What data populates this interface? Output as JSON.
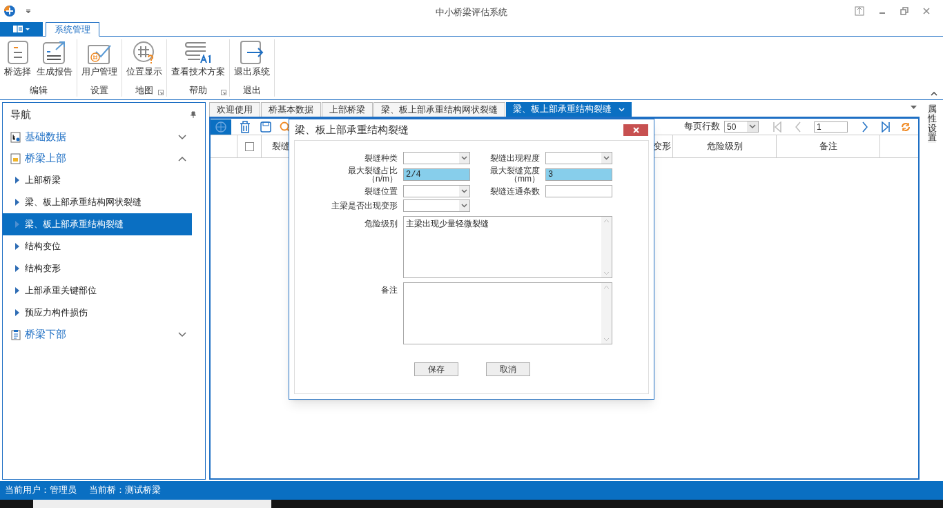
{
  "window": {
    "title": "中小桥梁评估系统"
  },
  "ribbon": {
    "tabs": [
      {
        "label": "系统管理",
        "selected": true
      }
    ],
    "groups": [
      {
        "label": "编辑",
        "launcher": false,
        "buttons": [
          {
            "kind": "list",
            "label": "桥选择"
          },
          {
            "kind": "report",
            "label": "生成报告"
          }
        ]
      },
      {
        "label": "设置",
        "launcher": false,
        "buttons": [
          {
            "kind": "user",
            "label": "用户管理"
          }
        ]
      },
      {
        "label": "地图",
        "launcher": true,
        "buttons": [
          {
            "kind": "map",
            "label": "位置显示"
          }
        ]
      },
      {
        "label": "帮助",
        "launcher": true,
        "buttons": [
          {
            "kind": "book",
            "label": "查看技术方案"
          }
        ]
      },
      {
        "label": "退出",
        "launcher": false,
        "buttons": [
          {
            "kind": "exit",
            "label": "退出系统"
          }
        ]
      }
    ]
  },
  "nav": {
    "title": "导航",
    "groups": [
      {
        "label": "基础数据",
        "kind": "data",
        "expanded": false
      },
      {
        "label": "桥梁上部",
        "kind": "folder",
        "expanded": true,
        "children": [
          {
            "label": "上部桥梁",
            "selected": false
          },
          {
            "label": "梁、板上部承重结构网状裂缝",
            "selected": false
          },
          {
            "label": "梁、板上部承重结构裂缝",
            "selected": true
          },
          {
            "label": "结构变位",
            "selected": false
          },
          {
            "label": "结构变形",
            "selected": false
          },
          {
            "label": "上部承重关键部位",
            "selected": false
          },
          {
            "label": "预应力构件损伤",
            "selected": false
          }
        ]
      },
      {
        "label": "桥梁下部",
        "kind": "clipboard",
        "expanded": false
      }
    ]
  },
  "doc_tabs": [
    {
      "label": "欢迎使用",
      "selected": false
    },
    {
      "label": "桥基本数据",
      "selected": false
    },
    {
      "label": "上部桥梁",
      "selected": false
    },
    {
      "label": "梁、板上部承重结构网状裂缝",
      "selected": false
    },
    {
      "label": "梁、板上部承重结构裂缝",
      "selected": true
    }
  ],
  "pager": {
    "rows_label": "每页行数",
    "rows_per_page": "50",
    "page": "1"
  },
  "table": {
    "header_checked": false,
    "columns": [
      "裂缝",
      "变形",
      "危险级别",
      "备注"
    ]
  },
  "dialog": {
    "title": "梁、板上部承重结构裂缝",
    "fields": [
      {
        "kind": "combo",
        "label": "裂缝种类",
        "highlighted": false
      },
      {
        "kind": "combo",
        "label": "裂缝出现程度",
        "highlighted": false
      },
      {
        "kind": "text",
        "label": "最大裂缝占比（n/m）",
        "value": "2/4",
        "highlighted": true
      },
      {
        "kind": "text",
        "label": "最大裂缝宽度（mm）",
        "value": "3",
        "highlighted": true
      },
      {
        "kind": "combo",
        "label": "裂缝位置",
        "highlighted": false
      },
      {
        "kind": "text",
        "label": "裂缝连通条数",
        "highlighted": false
      },
      {
        "kind": "combo",
        "label": "主梁是否出现变形",
        "highlighted": false
      },
      {
        "kind": "memo",
        "label": "危险级别",
        "value": "主梁出现少量轻微裂缝"
      },
      {
        "kind": "memo",
        "label": "备注"
      }
    ],
    "buttons": [
      "保存",
      "取消"
    ]
  },
  "side_tab": "属性设置",
  "status_bar": [
    "当前用户：管理员",
    "当前桥：测试桥梁"
  ]
}
